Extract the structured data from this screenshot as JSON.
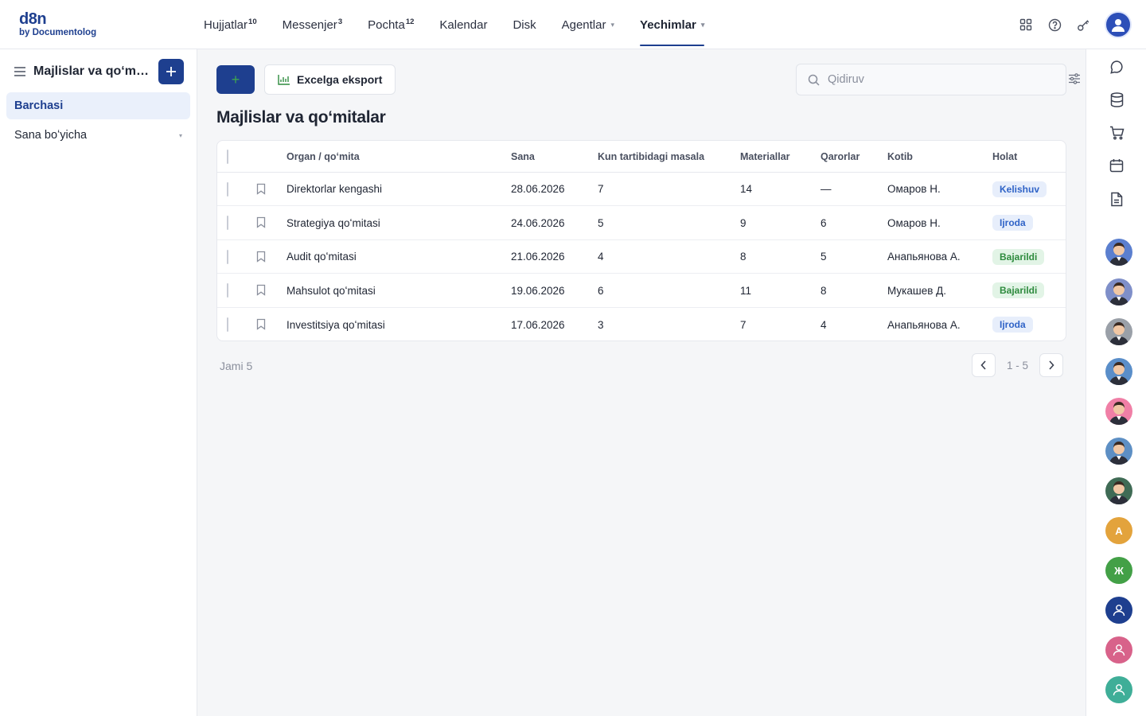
{
  "logo": {
    "line1": "d8n",
    "line2": "by Documentolog"
  },
  "nav": [
    {
      "label": "Hujjatlar",
      "badge": "10"
    },
    {
      "label": "Messenjer",
      "badge": "3"
    },
    {
      "label": "Pochta",
      "badge": "12"
    },
    {
      "label": "Kalendar",
      "badge": ""
    },
    {
      "label": "Disk",
      "badge": ""
    },
    {
      "label": "Agentlar",
      "badge": "",
      "dropdown": true
    },
    {
      "label": "Yechimlar",
      "badge": "",
      "dropdown": true,
      "active": true
    }
  ],
  "top_icons": [
    "apps-grid-icon",
    "help-circle-icon",
    "key-icon",
    "user-avatar"
  ],
  "sidebar": {
    "title": "Majlislar va qoʻmitalar",
    "items": [
      {
        "label": "Barchasi",
        "active": true
      },
      {
        "label": "Sana boʻyicha",
        "dropdown": true
      }
    ]
  },
  "toolbar": {
    "add_label": "+",
    "export_label": "Excelga eksport",
    "search_placeholder": "Qidiruv"
  },
  "page_title": "Majlislar va qoʻmitalar",
  "table": {
    "columns": [
      "Organ / qoʻmita",
      "Sana",
      "Kun tartibidagi masala",
      "Materiallar",
      "Qarorlar",
      "Kotib",
      "Holat"
    ],
    "rows": [
      {
        "organ": "Direktorlar kengashi",
        "date": "28.06.2026",
        "agenda": "7",
        "materials": "14",
        "decisions": "—",
        "secretary": "Омаров Н.",
        "status": "Kelishuv",
        "status_kind": "blue"
      },
      {
        "organ": "Strategiya qoʻmitasi",
        "date": "24.06.2026",
        "agenda": "5",
        "materials": "9",
        "decisions": "6",
        "secretary": "Омаров Н.",
        "status": "Ijroda",
        "status_kind": "blue"
      },
      {
        "organ": "Audit qoʻmitasi",
        "date": "21.06.2026",
        "agenda": "4",
        "materials": "8",
        "decisions": "5",
        "secretary": "Анапьянова А.",
        "status": "Bajarildi",
        "status_kind": "green"
      },
      {
        "organ": "Mahsulot qoʻmitasi",
        "date": "19.06.2026",
        "agenda": "6",
        "materials": "11",
        "decisions": "8",
        "secretary": "Мукашев Д.",
        "status": "Bajarildi",
        "status_kind": "green"
      },
      {
        "organ": "Investitsiya qoʻmitasi",
        "date": "17.06.2026",
        "agenda": "3",
        "materials": "7",
        "decisions": "4",
        "secretary": "Анапьянова А.",
        "status": "Ijroda",
        "status_kind": "blue"
      }
    ]
  },
  "footer": {
    "total": "Jami 5",
    "range": "1 - 5"
  },
  "rail": {
    "icons": [
      "chat-icon",
      "database-icon",
      "cart-icon",
      "calendar-icon",
      "document-icon"
    ],
    "avatars": [
      {
        "kind": "photo",
        "bg": "#5b7fcf"
      },
      {
        "kind": "photo",
        "bg": "#7f8fc9"
      },
      {
        "kind": "photo",
        "bg": "#9aa0a8"
      },
      {
        "kind": "photo",
        "bg": "#5a8ec9"
      },
      {
        "kind": "photo",
        "bg": "#f07fa6"
      },
      {
        "kind": "photo",
        "bg": "#5d8fc4"
      },
      {
        "kind": "photo",
        "bg": "#3f6b55"
      },
      {
        "kind": "letter",
        "text": "A",
        "bg": "#e3a33c"
      },
      {
        "kind": "letter",
        "text": "Ж",
        "bg": "#43a047"
      },
      {
        "kind": "user",
        "bg": "#1e3f8f"
      },
      {
        "kind": "user",
        "bg": "#d8628a"
      },
      {
        "kind": "user",
        "bg": "#3fae98"
      }
    ]
  },
  "colors": {
    "accent": "#1e3f8f",
    "badge_blue_bg": "#e7eefb",
    "badge_blue_text": "#2f63c7",
    "badge_green_bg": "#e2f4e6",
    "badge_green_text": "#2e8b3e"
  }
}
